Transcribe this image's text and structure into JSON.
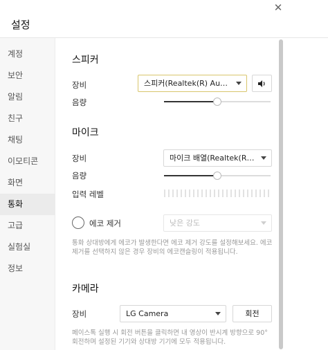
{
  "window": {
    "title": "설정",
    "close_glyph": "✕"
  },
  "sidebar": {
    "items": [
      {
        "label": "계정"
      },
      {
        "label": "보안"
      },
      {
        "label": "알림"
      },
      {
        "label": "친구"
      },
      {
        "label": "채팅"
      },
      {
        "label": "이모티콘"
      },
      {
        "label": "화면"
      },
      {
        "label": "통화",
        "active": true
      },
      {
        "label": "고급"
      },
      {
        "label": "실험실"
      },
      {
        "label": "정보"
      }
    ]
  },
  "speaker": {
    "title": "스피커",
    "device_label": "장비",
    "device_value": "스피커(Realtek(R) Audio)",
    "volume_label": "음량",
    "volume_fraction": 0.5,
    "test_icon": "speaker-icon"
  },
  "mic": {
    "title": "마이크",
    "device_label": "장비",
    "device_value": "마이크 배열(Realtek(R) Au...",
    "volume_label": "음량",
    "volume_fraction": 0.5,
    "input_level_label": "입력 레벨",
    "input_level_fraction": 0
  },
  "echo": {
    "label": "에코 제거",
    "enabled": false,
    "strength_value": "낮은 강도",
    "description": "통화 상대방에게 에코가 발생한다면 에코 제거 강도를 설정해보세요. 에코 제거를 선택하지 않은 경우 장비의 에코캔슬링이 적용됩니다."
  },
  "camera": {
    "title": "카메라",
    "device_label": "장비",
    "device_value": "LG Camera",
    "rotate_label": "회전",
    "description": "페이스톡 실행 시 회전 버튼을 클릭하면 내 영상이 반시계 방향으로 90° 회전하며 설정된 기기와 상대방 기기에 모두 적용됩니다."
  },
  "colors": {
    "accent_border": "#d8c56b",
    "sidebar_bg": "#f7f7f7",
    "active_bg": "#ebebeb"
  }
}
